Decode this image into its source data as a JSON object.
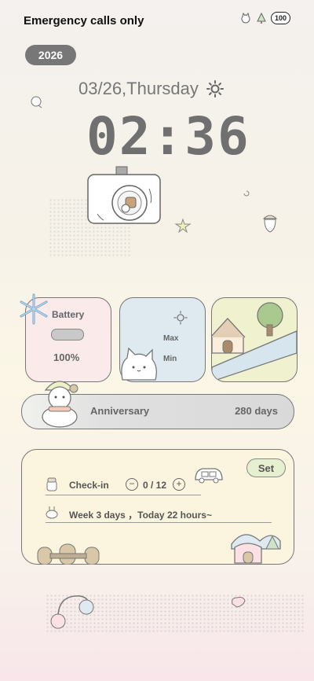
{
  "status_bar": {
    "carrier_text": "Emergency calls only",
    "battery_level": "100"
  },
  "year": "2026",
  "date_text": "03/26,Thursday",
  "time": "02:36",
  "widgets": {
    "battery": {
      "label": "Battery",
      "percent": "100%",
      "fill_fraction": 1.0
    },
    "weather": {
      "max_label": "Max",
      "min_label": "Min"
    }
  },
  "anniversary": {
    "label": "Anniversary",
    "value": "280 days"
  },
  "tasks": {
    "set_label": "Set",
    "checkin": {
      "label": "Check-in",
      "count": "0 / 12",
      "minus": "−",
      "plus": "+"
    },
    "week_text": "Week 3 days ，Today 22 hours~"
  },
  "colors": {
    "accent_gray": "#777777",
    "battery_card": "#fbeaea",
    "weather_card": "#dfeaf0",
    "picture_card": "#f0f2cf",
    "task_card": "#fbf5df",
    "set_button": "#e6efcf"
  }
}
